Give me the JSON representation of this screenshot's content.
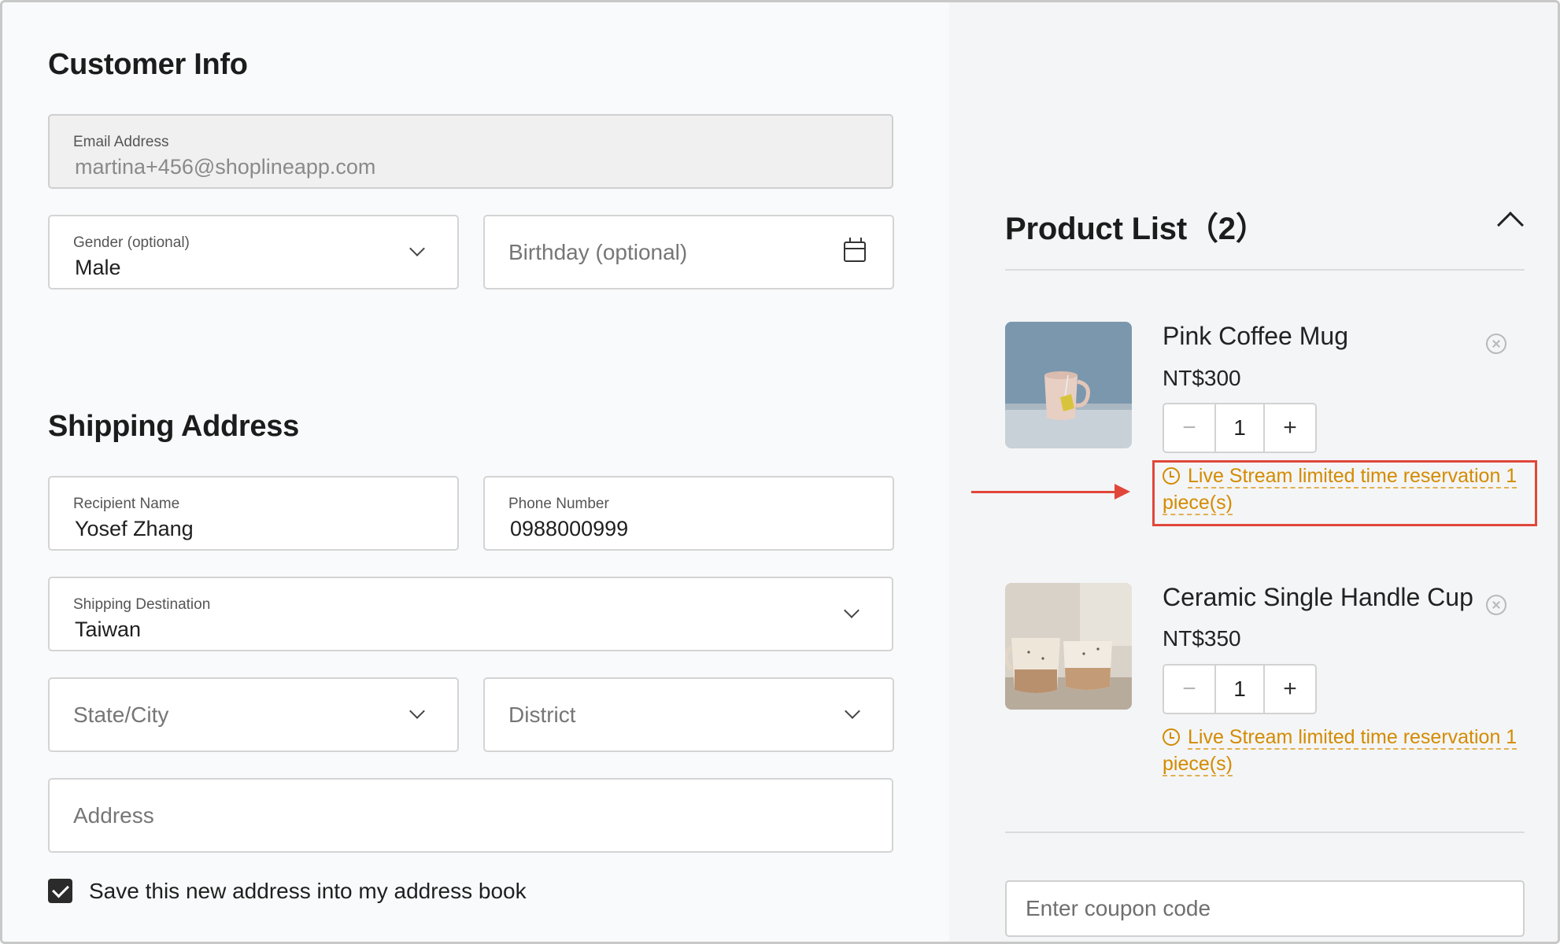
{
  "customer_info": {
    "title": "Customer Info",
    "email": {
      "label": "Email Address",
      "value": "martina+456@shoplineapp.com"
    },
    "gender": {
      "label": "Gender (optional)",
      "value": "Male"
    },
    "birthday": {
      "placeholder": "Birthday (optional)"
    }
  },
  "shipping": {
    "title": "Shipping Address",
    "recipient": {
      "label": "Recipient Name",
      "value": "Yosef Zhang"
    },
    "phone": {
      "label": "Phone Number",
      "value": "0988000999"
    },
    "destination": {
      "label": "Shipping Destination",
      "value": "Taiwan"
    },
    "state_city": {
      "placeholder": "State/City"
    },
    "district": {
      "placeholder": "District"
    },
    "address": {
      "placeholder": "Address"
    },
    "save_address": {
      "label": "Save this new address into my address book",
      "checked": true
    }
  },
  "product_list": {
    "title": "Product List（2）",
    "items": [
      {
        "name": "Pink Coffee Mug",
        "price": "NT$300",
        "quantity": "1",
        "notice": "Live Stream limited time reservation 1 piece(s)"
      },
      {
        "name": "Ceramic Single Handle Cup",
        "price": "NT$350",
        "quantity": "1",
        "notice": "Live Stream limited time reservation 1 piece(s)"
      }
    ],
    "stepper": {
      "minus": "−",
      "plus": "+"
    }
  },
  "coupon": {
    "placeholder": "Enter coupon code"
  },
  "colors": {
    "notice": "#d38b00",
    "highlight": "#e0473a",
    "panel_right": "#f4f5f6"
  },
  "icons": [
    "chevron-down-icon",
    "calendar-icon",
    "chevron-up-icon",
    "remove-icon",
    "clock-icon",
    "checkmark-icon"
  ]
}
